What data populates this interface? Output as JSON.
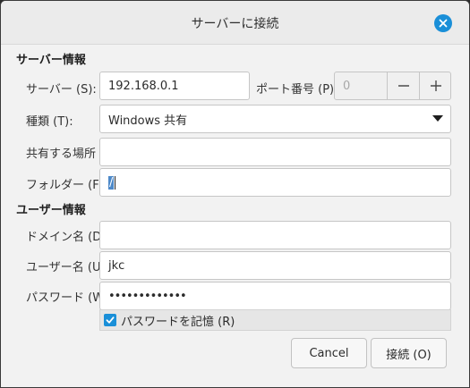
{
  "window": {
    "title": "サーバーに接続"
  },
  "server_info": {
    "heading": "サーバー情報",
    "server_label": "サーバー (S):",
    "server_value": "192.168.0.1",
    "port_label": "ポート番号 (P):",
    "port_value": "0",
    "type_label": "種類 (T):",
    "type_value": "Windows 共有",
    "share_label": "共有する場所 (A):",
    "share_value": "",
    "folder_label": "フォルダー (F):",
    "folder_value": "/"
  },
  "user_info": {
    "heading": "ユーザー情報",
    "domain_label": "ドメイン名 (D):",
    "domain_value": "",
    "username_label": "ユーザー名 (U):",
    "username_value": "jkc",
    "password_label": "パスワード (W):",
    "password_value": "•••••••••••••",
    "remember_label": "パスワードを記憶 (R)",
    "remember_checked": true
  },
  "buttons": {
    "cancel": "Cancel",
    "connect": "接続 (O)"
  },
  "icons": {
    "close": "close-icon",
    "minus": "minus-icon",
    "plus": "plus-icon",
    "dropdown": "triangle-down-icon",
    "check": "check-icon"
  },
  "colors": {
    "accent": "#1a8fd8",
    "selection": "#4d89c9",
    "dialog_bg": "#f2f2f2"
  }
}
